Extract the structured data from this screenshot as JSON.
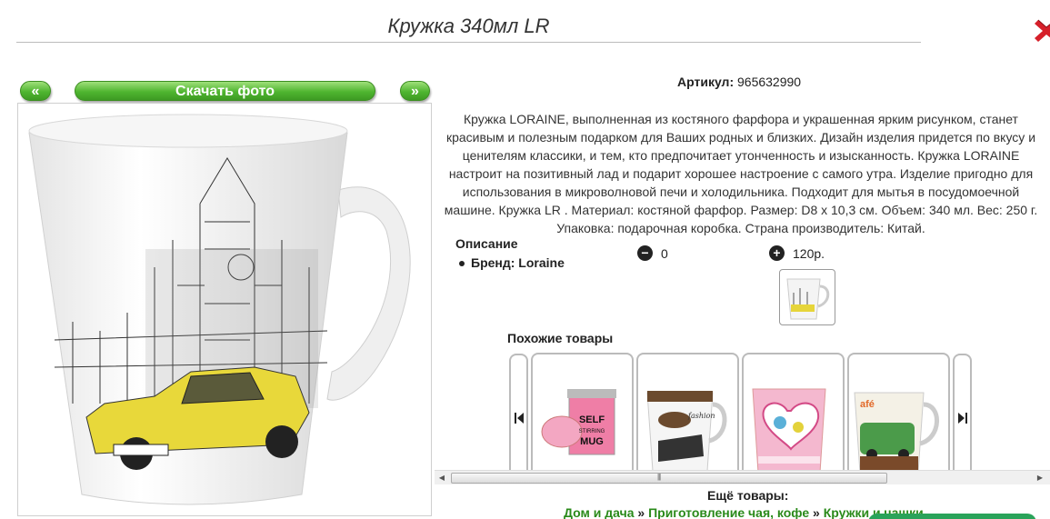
{
  "page": {
    "title": "Кружка 340мл LR"
  },
  "gallery": {
    "prev_label": "«",
    "download_label": "Скачать фото",
    "next_label": "»"
  },
  "product": {
    "article_label": "Артикул:",
    "article_value": "965632990",
    "description": "Кружка LORAINE, выполненная из костяного фарфора и украшенная ярким рисунком, станет красивым и полезным подарком для Ваших родных и близких. Дизайн изделия придется по вкусу и ценителям классики, и тем, кто предпочитает утонченность и изысканность. Кружка LORAINE настроит на позитивный лад и подарит хорошее настроение с самого утра. Изделие пригодно для использования в микроволновой печи и холодильника. Подходит для мытья в посудомоечной машине. Кружка LR . Материал: костяной фарфор. Размер: D8 х 10,3 см. Объем: 340 мл. Вес: 250 г. Упаковка: подарочная коробка. Страна производитель: Китай.",
    "section_title": "Описание",
    "brand_label": "Бренд: Loraine",
    "quantity": "0",
    "price": "120р."
  },
  "similar": {
    "title": "Похожие товары",
    "cards": [
      {
        "name": "self-stirring-mug",
        "text": "SELF STIRRING MUG"
      },
      {
        "name": "fashion-mug",
        "text": "fashion"
      },
      {
        "name": "heart-mug",
        "text": ""
      },
      {
        "name": "cafe-car-mug",
        "text": "afé"
      }
    ]
  },
  "more": {
    "title": "Ещё товары:",
    "crumbs": [
      "Дом и дача",
      "Приготовление чая, кофе",
      "Кружки и чашки"
    ],
    "separator": "»"
  },
  "colors": {
    "green_button": "#4fb530",
    "link_green": "#2a8a1a",
    "close_red": "#d6202a"
  }
}
